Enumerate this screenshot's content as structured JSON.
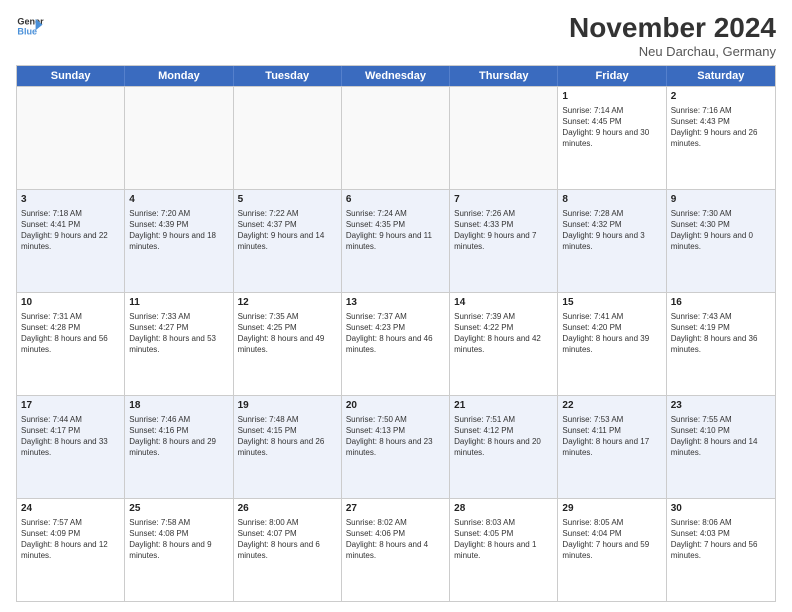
{
  "logo": {
    "line1": "General",
    "line2": "Blue"
  },
  "title": "November 2024",
  "subtitle": "Neu Darchau, Germany",
  "headers": [
    "Sunday",
    "Monday",
    "Tuesday",
    "Wednesday",
    "Thursday",
    "Friday",
    "Saturday"
  ],
  "rows": [
    [
      {
        "day": "",
        "info": ""
      },
      {
        "day": "",
        "info": ""
      },
      {
        "day": "",
        "info": ""
      },
      {
        "day": "",
        "info": ""
      },
      {
        "day": "",
        "info": ""
      },
      {
        "day": "1",
        "info": "Sunrise: 7:14 AM\nSunset: 4:45 PM\nDaylight: 9 hours and 30 minutes."
      },
      {
        "day": "2",
        "info": "Sunrise: 7:16 AM\nSunset: 4:43 PM\nDaylight: 9 hours and 26 minutes."
      }
    ],
    [
      {
        "day": "3",
        "info": "Sunrise: 7:18 AM\nSunset: 4:41 PM\nDaylight: 9 hours and 22 minutes."
      },
      {
        "day": "4",
        "info": "Sunrise: 7:20 AM\nSunset: 4:39 PM\nDaylight: 9 hours and 18 minutes."
      },
      {
        "day": "5",
        "info": "Sunrise: 7:22 AM\nSunset: 4:37 PM\nDaylight: 9 hours and 14 minutes."
      },
      {
        "day": "6",
        "info": "Sunrise: 7:24 AM\nSunset: 4:35 PM\nDaylight: 9 hours and 11 minutes."
      },
      {
        "day": "7",
        "info": "Sunrise: 7:26 AM\nSunset: 4:33 PM\nDaylight: 9 hours and 7 minutes."
      },
      {
        "day": "8",
        "info": "Sunrise: 7:28 AM\nSunset: 4:32 PM\nDaylight: 9 hours and 3 minutes."
      },
      {
        "day": "9",
        "info": "Sunrise: 7:30 AM\nSunset: 4:30 PM\nDaylight: 9 hours and 0 minutes."
      }
    ],
    [
      {
        "day": "10",
        "info": "Sunrise: 7:31 AM\nSunset: 4:28 PM\nDaylight: 8 hours and 56 minutes."
      },
      {
        "day": "11",
        "info": "Sunrise: 7:33 AM\nSunset: 4:27 PM\nDaylight: 8 hours and 53 minutes."
      },
      {
        "day": "12",
        "info": "Sunrise: 7:35 AM\nSunset: 4:25 PM\nDaylight: 8 hours and 49 minutes."
      },
      {
        "day": "13",
        "info": "Sunrise: 7:37 AM\nSunset: 4:23 PM\nDaylight: 8 hours and 46 minutes."
      },
      {
        "day": "14",
        "info": "Sunrise: 7:39 AM\nSunset: 4:22 PM\nDaylight: 8 hours and 42 minutes."
      },
      {
        "day": "15",
        "info": "Sunrise: 7:41 AM\nSunset: 4:20 PM\nDaylight: 8 hours and 39 minutes."
      },
      {
        "day": "16",
        "info": "Sunrise: 7:43 AM\nSunset: 4:19 PM\nDaylight: 8 hours and 36 minutes."
      }
    ],
    [
      {
        "day": "17",
        "info": "Sunrise: 7:44 AM\nSunset: 4:17 PM\nDaylight: 8 hours and 33 minutes."
      },
      {
        "day": "18",
        "info": "Sunrise: 7:46 AM\nSunset: 4:16 PM\nDaylight: 8 hours and 29 minutes."
      },
      {
        "day": "19",
        "info": "Sunrise: 7:48 AM\nSunset: 4:15 PM\nDaylight: 8 hours and 26 minutes."
      },
      {
        "day": "20",
        "info": "Sunrise: 7:50 AM\nSunset: 4:13 PM\nDaylight: 8 hours and 23 minutes."
      },
      {
        "day": "21",
        "info": "Sunrise: 7:51 AM\nSunset: 4:12 PM\nDaylight: 8 hours and 20 minutes."
      },
      {
        "day": "22",
        "info": "Sunrise: 7:53 AM\nSunset: 4:11 PM\nDaylight: 8 hours and 17 minutes."
      },
      {
        "day": "23",
        "info": "Sunrise: 7:55 AM\nSunset: 4:10 PM\nDaylight: 8 hours and 14 minutes."
      }
    ],
    [
      {
        "day": "24",
        "info": "Sunrise: 7:57 AM\nSunset: 4:09 PM\nDaylight: 8 hours and 12 minutes."
      },
      {
        "day": "25",
        "info": "Sunrise: 7:58 AM\nSunset: 4:08 PM\nDaylight: 8 hours and 9 minutes."
      },
      {
        "day": "26",
        "info": "Sunrise: 8:00 AM\nSunset: 4:07 PM\nDaylight: 8 hours and 6 minutes."
      },
      {
        "day": "27",
        "info": "Sunrise: 8:02 AM\nSunset: 4:06 PM\nDaylight: 8 hours and 4 minutes."
      },
      {
        "day": "28",
        "info": "Sunrise: 8:03 AM\nSunset: 4:05 PM\nDaylight: 8 hours and 1 minute."
      },
      {
        "day": "29",
        "info": "Sunrise: 8:05 AM\nSunset: 4:04 PM\nDaylight: 7 hours and 59 minutes."
      },
      {
        "day": "30",
        "info": "Sunrise: 8:06 AM\nSunset: 4:03 PM\nDaylight: 7 hours and 56 minutes."
      }
    ]
  ]
}
